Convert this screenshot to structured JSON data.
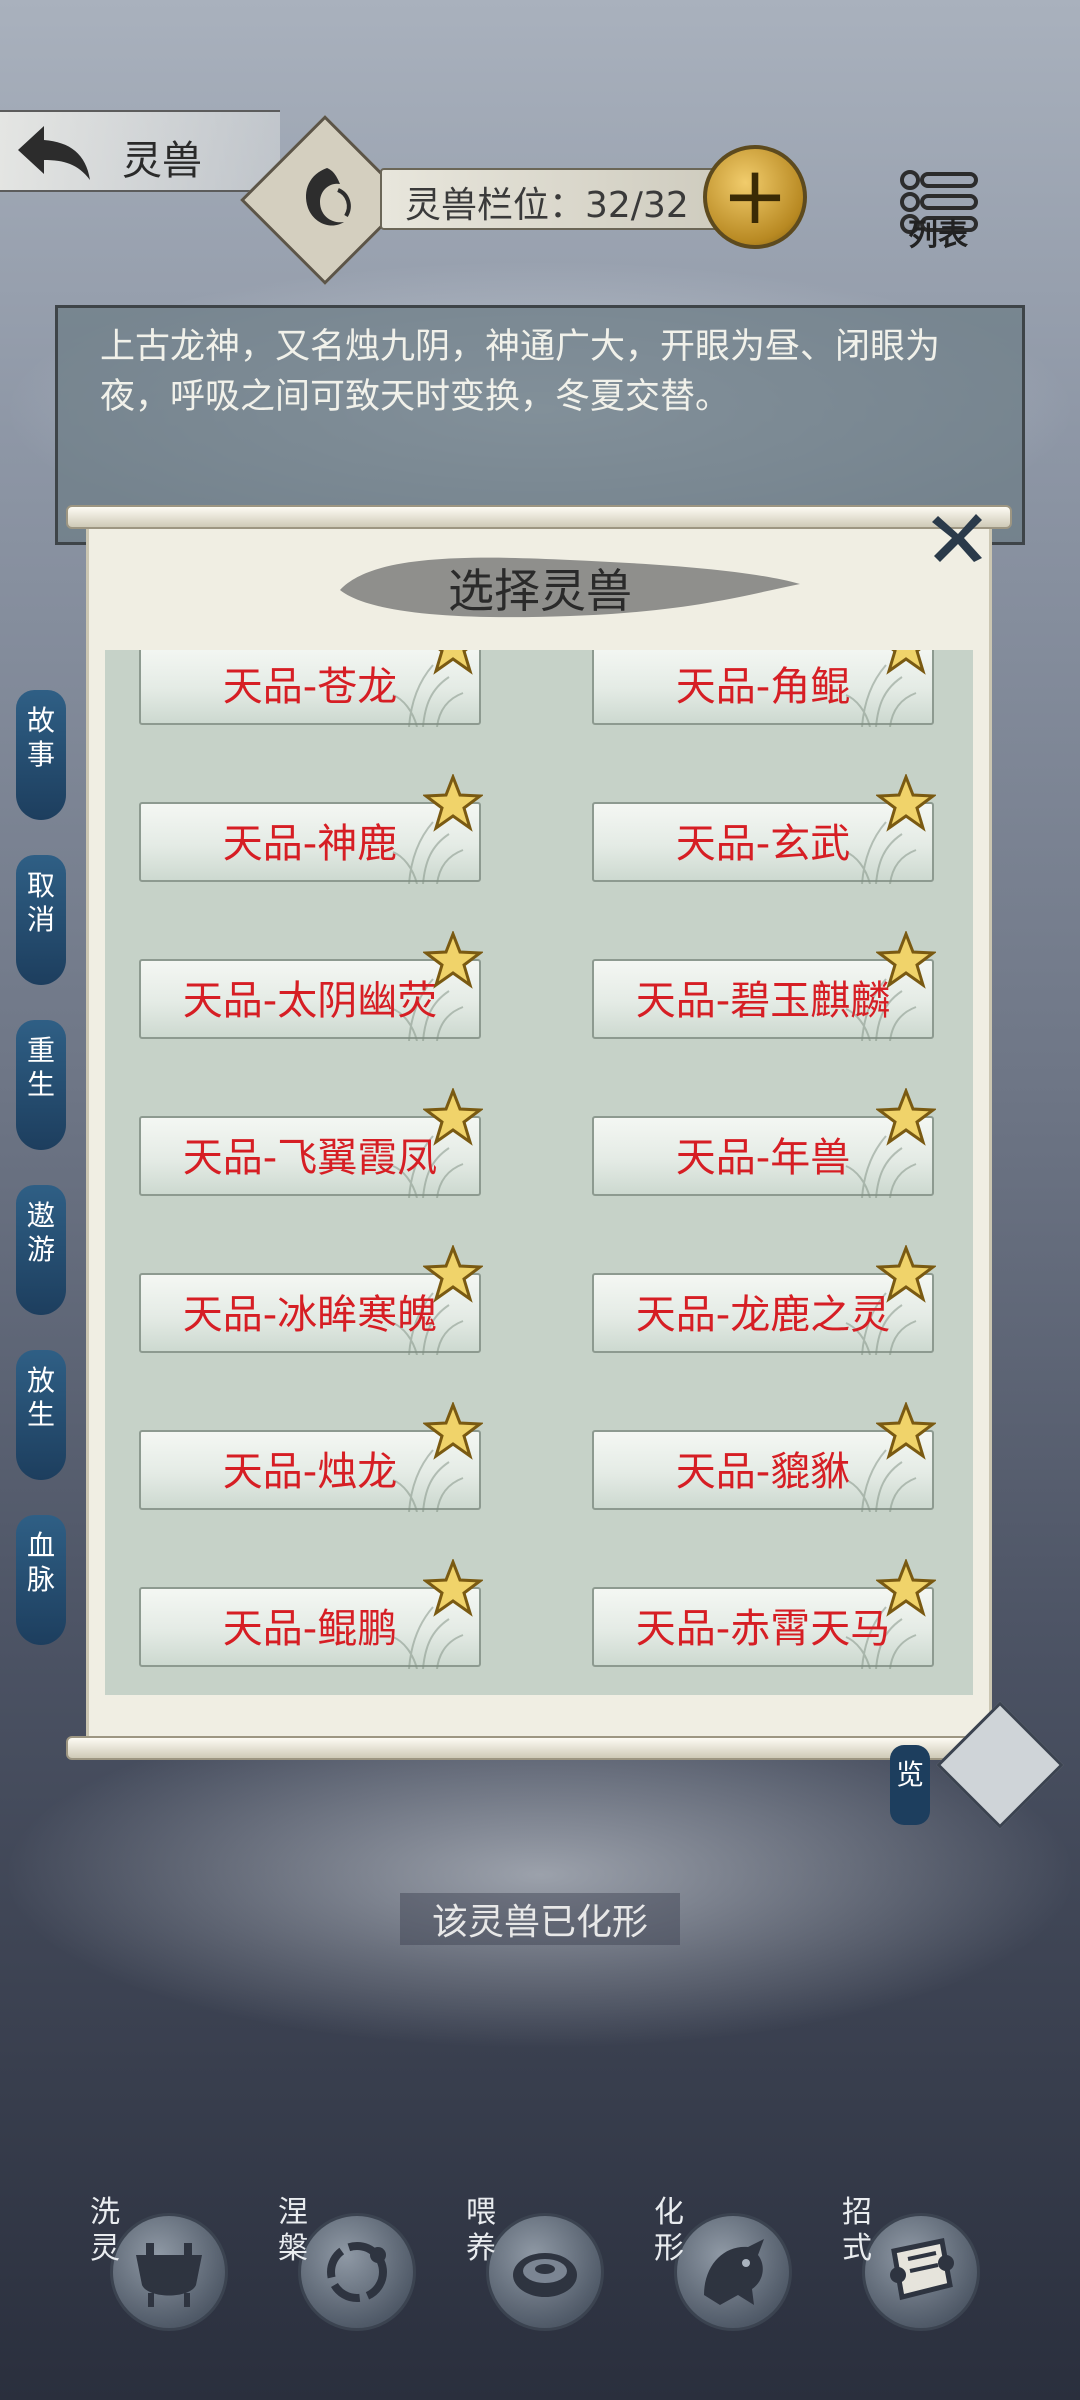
{
  "header": {
    "title": "灵兽",
    "slot_text": "灵兽栏位：32/32",
    "add_label": "+",
    "list_label": "列表"
  },
  "description": "上古龙神，又名烛九阴，神通广大，开眼为昼、闭眼为夜，呼吸之间可致天时变换，冬夏交替。",
  "side_menu": [
    "故事",
    "取消",
    "重生",
    "遨游",
    "放生",
    "血脉"
  ],
  "modal": {
    "title": "选择灵兽",
    "beasts": [
      "天品-苍龙",
      "天品-角鲲",
      "天品-神鹿",
      "天品-玄武",
      "天品-太阴幽荧",
      "天品-碧玉麒麟",
      "天品-飞翼霞凤",
      "天品-年兽",
      "天品-冰眸寒魄",
      "天品-龙鹿之灵",
      "天品-烛龙",
      "天品-貔貅",
      "天品-鲲鹏",
      "天品-赤霄天马"
    ]
  },
  "status_caption": "该灵兽已化形",
  "right_partial_label": "览",
  "actions": [
    {
      "label": "洗灵",
      "icon": "cauldron-icon"
    },
    {
      "label": "涅槃",
      "icon": "dragon-ring-icon"
    },
    {
      "label": "喂养",
      "icon": "meat-icon"
    },
    {
      "label": "化形",
      "icon": "dragon-head-icon"
    },
    {
      "label": "招式",
      "icon": "scroll-icon"
    }
  ],
  "colors": {
    "beast_label": "#d61e24",
    "side_button": "#1d3e5e",
    "gold": "#c9a03a"
  }
}
